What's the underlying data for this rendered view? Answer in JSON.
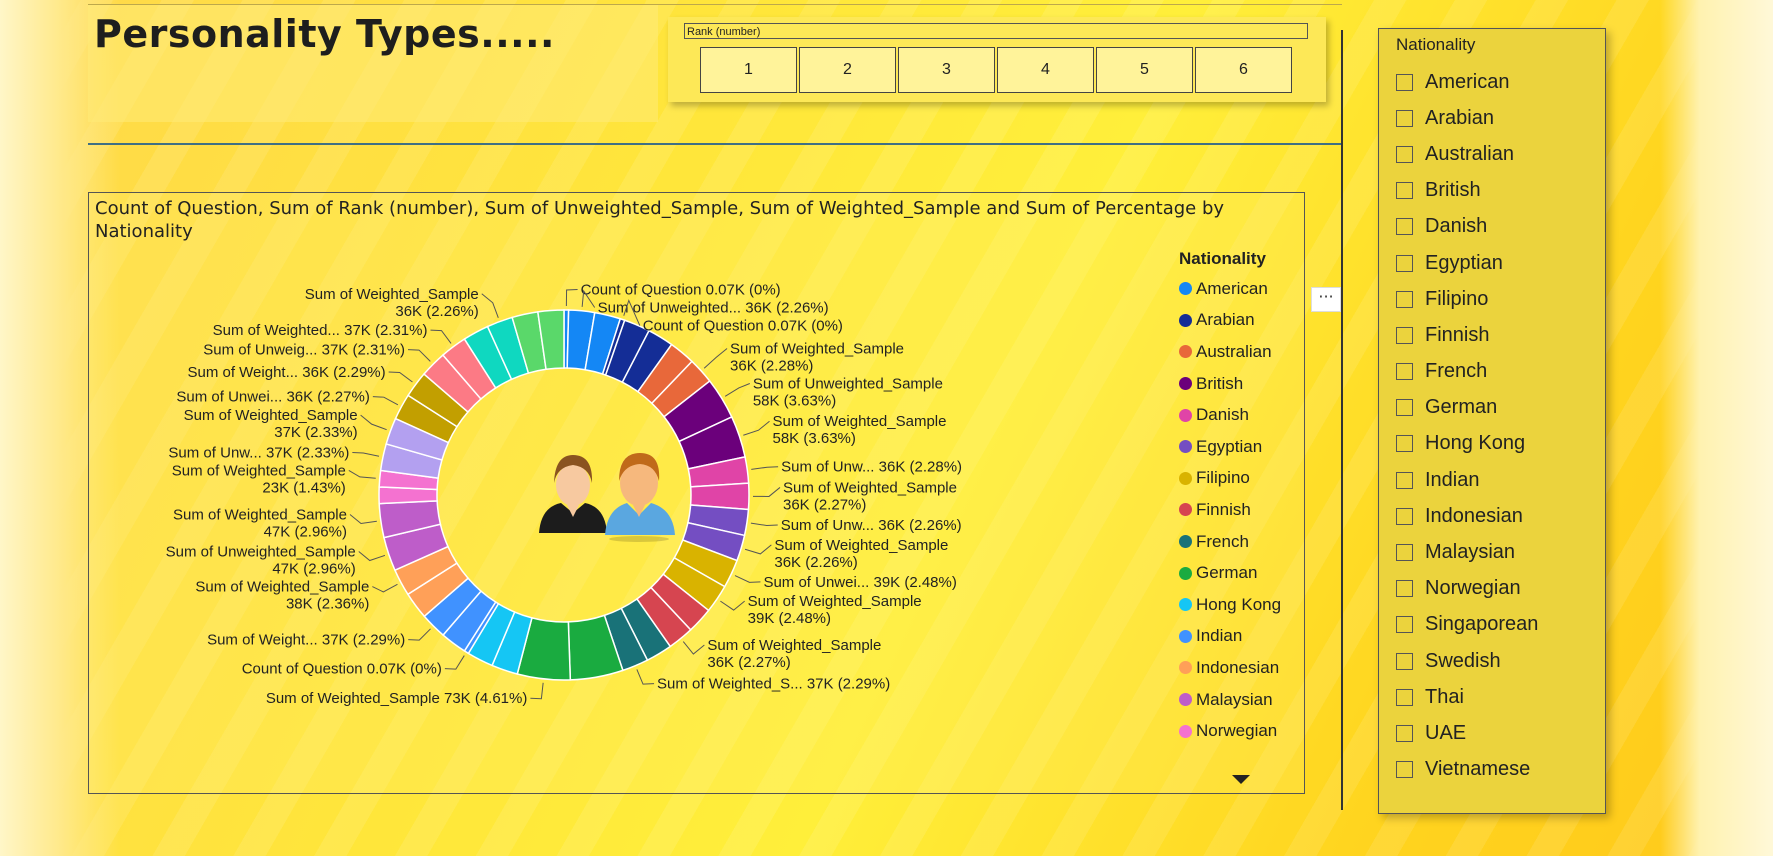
{
  "page": {
    "title": "Personality Types....."
  },
  "rank_slicer": {
    "title": "Rank (number)",
    "options": [
      "1",
      "2",
      "3",
      "4",
      "5",
      "6"
    ]
  },
  "visual": {
    "title": "Count of Question, Sum of Rank (number), Sum of Unweighted_Sample, Sum of Weighted_Sample and Sum of Percentage by Nationality",
    "more_options": "···",
    "center_icon": "person-couple-icon"
  },
  "legend": {
    "title": "Nationality",
    "items": [
      {
        "label": "American",
        "color": "#1487f5"
      },
      {
        "label": "Arabian",
        "color": "#142d96"
      },
      {
        "label": "Australian",
        "color": "#e8683a"
      },
      {
        "label": "British",
        "color": "#6b007b"
      },
      {
        "label": "Danish",
        "color": "#e044a7"
      },
      {
        "label": "Egyptian",
        "color": "#744ec2"
      },
      {
        "label": "Filipino",
        "color": "#d9b300"
      },
      {
        "label": "Finnish",
        "color": "#d64550"
      },
      {
        "label": "French",
        "color": "#197278"
      },
      {
        "label": "German",
        "color": "#1aab40"
      },
      {
        "label": "Hong Kong",
        "color": "#15c6f4"
      },
      {
        "label": "Indian",
        "color": "#4092ff"
      },
      {
        "label": "Indonesian",
        "color": "#ffa058"
      },
      {
        "label": "Malaysian",
        "color": "#be5dc9"
      },
      {
        "label": "Norwegian",
        "color": "#f472d0"
      }
    ]
  },
  "chart_data": {
    "type": "pie",
    "variant": "donut",
    "title": "Count of Question, Sum of Rank (number), Sum of Unweighted_Sample, Sum of Weighted_Sample and Sum of Percentage by Nationality",
    "legend_title": "Nationality",
    "legend_position": "right",
    "slices": [
      {
        "nationality": "American",
        "measure": "Count of Question",
        "label": "Count of Question 0.07K (0%)",
        "percent": 0.004,
        "color": "#1487f5",
        "side": "right"
      },
      {
        "nationality": "American",
        "measure": "Sum of Unweighted_Sample",
        "label": "Sum of Unweighted... 36K (2.26%)",
        "percent": 2.26,
        "color": "#1487f5",
        "side": "right"
      },
      {
        "nationality": "American",
        "measure": "Sum of Weighted_Sample",
        "label": "",
        "percent": 2.26,
        "color": "#1487f5",
        "side": "right"
      },
      {
        "nationality": "Arabian",
        "measure": "Count of Question",
        "label": "Count of Question 0.07K (0%)",
        "percent": 0.004,
        "color": "#142d96",
        "side": "right"
      },
      {
        "nationality": "Arabian",
        "measure": "Sum of Unweighted_Sample",
        "label": "",
        "percent": 2.28,
        "color": "#142d96",
        "side": "right"
      },
      {
        "nationality": "Arabian",
        "measure": "Sum of Weighted_Sample",
        "label": "",
        "percent": 2.28,
        "color": "#142d96",
        "side": "right"
      },
      {
        "nationality": "Australian",
        "measure": "Sum of Unweighted_Sample",
        "label": "",
        "percent": 2.28,
        "color": "#e8683a",
        "side": "right"
      },
      {
        "nationality": "Australian",
        "measure": "Sum of Weighted_Sample",
        "label": "Sum of Weighted_Sample\n36K (2.28%)",
        "percent": 2.28,
        "color": "#e8683a",
        "side": "right"
      },
      {
        "nationality": "British",
        "measure": "Sum of Unweighted_Sample",
        "label": "Sum of Unweighted_Sample\n58K (3.63%)",
        "percent": 3.63,
        "color": "#6b007b",
        "side": "right"
      },
      {
        "nationality": "British",
        "measure": "Sum of Weighted_Sample",
        "label": "Sum of Weighted_Sample\n58K (3.63%)",
        "percent": 3.63,
        "color": "#6b007b",
        "side": "right"
      },
      {
        "nationality": "Danish",
        "measure": "Sum of Unweighted_Sample",
        "label": "Sum of Unw... 36K (2.28%)",
        "percent": 2.28,
        "color": "#e044a7",
        "side": "right"
      },
      {
        "nationality": "Danish",
        "measure": "Sum of Weighted_Sample",
        "label": "Sum of Weighted_Sample\n36K (2.27%)",
        "percent": 2.27,
        "color": "#e044a7",
        "side": "right"
      },
      {
        "nationality": "Egyptian",
        "measure": "Sum of Unweighted_Sample",
        "label": "Sum of Unw... 36K (2.26%)",
        "percent": 2.26,
        "color": "#744ec2",
        "side": "right"
      },
      {
        "nationality": "Egyptian",
        "measure": "Sum of Weighted_Sample",
        "label": "Sum of Weighted_Sample\n36K (2.26%)",
        "percent": 2.26,
        "color": "#744ec2",
        "side": "right"
      },
      {
        "nationality": "Filipino",
        "measure": "Sum of Unweighted_Sample",
        "label": "Sum of Unwei... 39K (2.48%)",
        "percent": 2.48,
        "color": "#d9b300",
        "side": "right"
      },
      {
        "nationality": "Filipino",
        "measure": "Sum of Weighted_Sample",
        "label": "Sum of Weighted_Sample\n39K (2.48%)",
        "percent": 2.48,
        "color": "#d9b300",
        "side": "right"
      },
      {
        "nationality": "Finnish",
        "measure": "Sum of Unweighted_Sample",
        "label": "",
        "percent": 2.27,
        "color": "#d64550",
        "side": "right"
      },
      {
        "nationality": "Finnish",
        "measure": "Sum of Weighted_Sample",
        "label": "Sum of Weighted_Sample\n36K (2.27%)",
        "percent": 2.27,
        "color": "#d64550",
        "side": "right"
      },
      {
        "nationality": "French",
        "measure": "Sum of Unweighted_Sample",
        "label": "",
        "percent": 2.29,
        "color": "#197278",
        "side": "right"
      },
      {
        "nationality": "French",
        "measure": "Sum of Weighted_Sample",
        "label": "Sum of Weighted_S... 37K (2.29%)",
        "percent": 2.29,
        "color": "#197278",
        "side": "right"
      },
      {
        "nationality": "German",
        "measure": "Sum of Unweighted_Sample",
        "label": "",
        "percent": 4.61,
        "color": "#1aab40",
        "side": "left"
      },
      {
        "nationality": "German",
        "measure": "Sum of Weighted_Sample",
        "label": "Sum of Weighted_Sample 73K (4.61%)",
        "percent": 4.61,
        "color": "#1aab40",
        "side": "left"
      },
      {
        "nationality": "Hong Kong",
        "measure": "Sum of Unweighted_Sample",
        "label": "",
        "percent": 2.29,
        "color": "#15c6f4",
        "side": "left"
      },
      {
        "nationality": "Hong Kong",
        "measure": "Sum of Weighted_Sample",
        "label": "",
        "percent": 2.29,
        "color": "#15c6f4",
        "side": "left"
      },
      {
        "nationality": "Indian",
        "measure": "Count of Question",
        "label": "Count of Question 0.07K (0%)",
        "percent": 0.004,
        "color": "#4092ff",
        "side": "left"
      },
      {
        "nationality": "Indian",
        "measure": "Sum of Unweighted_Sample",
        "label": "",
        "percent": 2.29,
        "color": "#4092ff",
        "side": "left"
      },
      {
        "nationality": "Indian",
        "measure": "Sum of Weighted_Sample",
        "label": "Sum of Weight... 37K (2.29%)",
        "percent": 2.29,
        "color": "#4092ff",
        "side": "left"
      },
      {
        "nationality": "Indonesian",
        "measure": "Sum of Unweighted_Sample",
        "label": "",
        "percent": 2.36,
        "color": "#ffa058",
        "side": "left"
      },
      {
        "nationality": "Indonesian",
        "measure": "Sum of Weighted_Sample",
        "label": "Sum of Weighted_Sample\n38K (2.36%)",
        "percent": 2.36,
        "color": "#ffa058",
        "side": "left"
      },
      {
        "nationality": "Malaysian",
        "measure": "Sum of Unweighted_Sample",
        "label": "Sum of Unweighted_Sample\n47K (2.96%)",
        "percent": 2.96,
        "color": "#be5dc9",
        "side": "left"
      },
      {
        "nationality": "Malaysian",
        "measure": "Sum of Weighted_Sample",
        "label": "Sum of Weighted_Sample\n47K (2.96%)",
        "percent": 2.96,
        "color": "#be5dc9",
        "side": "left"
      },
      {
        "nationality": "Norwegian",
        "measure": "Sum of Unweighted_Sample",
        "label": "",
        "percent": 1.43,
        "color": "#f472d0",
        "side": "left"
      },
      {
        "nationality": "Norwegian",
        "measure": "Sum of Weighted_Sample",
        "label": "Sum of Weighted_Sample\n23K (1.43%)",
        "percent": 1.43,
        "color": "#f472d0",
        "side": "left"
      },
      {
        "nationality": "Singaporean",
        "measure": "Sum of Unweighted_Sample",
        "label": "Sum of Unw... 37K (2.33%)",
        "percent": 2.33,
        "color": "#b3a0f0",
        "side": "left"
      },
      {
        "nationality": "Singaporean",
        "measure": "Sum of Weighted_Sample",
        "label": "Sum of Weighted_Sample\n37K (2.33%)",
        "percent": 2.33,
        "color": "#b3a0f0",
        "side": "left"
      },
      {
        "nationality": "Swedish",
        "measure": "Sum of Unweighted_Sample",
        "label": "Sum of Unwei... 36K (2.27%)",
        "percent": 2.27,
        "color": "#c29f00",
        "side": "left"
      },
      {
        "nationality": "Swedish",
        "measure": "Sum of Weighted_Sample",
        "label": "Sum of Weight... 36K (2.29%)",
        "percent": 2.29,
        "color": "#c29f00",
        "side": "left"
      },
      {
        "nationality": "Thai",
        "measure": "Sum of Unweighted_Sample",
        "label": "Sum of Unweig... 37K (2.31%)",
        "percent": 2.31,
        "color": "#fc7a85",
        "side": "left"
      },
      {
        "nationality": "Thai",
        "measure": "Sum of Weighted_Sample",
        "label": "Sum of Weighted... 37K (2.31%)",
        "percent": 2.31,
        "color": "#fc7a85",
        "side": "left"
      },
      {
        "nationality": "UAE",
        "measure": "Sum of Unweighted_Sample",
        "label": "",
        "percent": 2.26,
        "color": "#0fd8c0",
        "side": "left"
      },
      {
        "nationality": "UAE",
        "measure": "Sum of Weighted_Sample",
        "label": "Sum of Weighted_Sample\n36K (2.26%)",
        "percent": 2.26,
        "color": "#0fd8c0",
        "side": "left"
      },
      {
        "nationality": "Vietnamese",
        "measure": "Sum of Unweighted_Sample",
        "label": "",
        "percent": 2.26,
        "color": "#5ad86a",
        "side": "left"
      },
      {
        "nationality": "Vietnamese",
        "measure": "Sum of Weighted_Sample",
        "label": "",
        "percent": 2.26,
        "color": "#5ad86a",
        "side": "left"
      }
    ]
  },
  "nationality_slicer": {
    "title": "Nationality",
    "options": [
      "American",
      "Arabian",
      "Australian",
      "British",
      "Danish",
      "Egyptian",
      "Filipino",
      "Finnish",
      "French",
      "German",
      "Hong Kong",
      "Indian",
      "Indonesian",
      "Malaysian",
      "Norwegian",
      "Singaporean",
      "Swedish",
      "Thai",
      "UAE",
      "Vietnamese"
    ]
  }
}
